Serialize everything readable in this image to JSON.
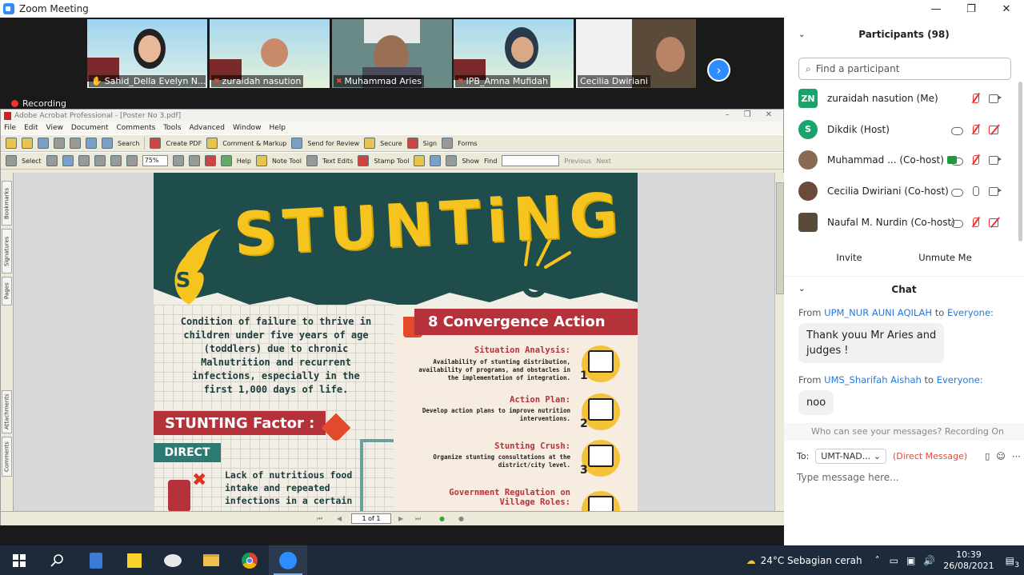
{
  "zoom": {
    "title": "Zoom Meeting",
    "recording": "Recording",
    "win_min": "—",
    "win_max": "❐",
    "win_close": "✕"
  },
  "videos": [
    {
      "name": "Sahid_Della Evelyn N..."
    },
    {
      "name": "zuraidah nasution"
    },
    {
      "name": "Muhammad Aries"
    },
    {
      "name": "IPB_Amna Mufidah"
    },
    {
      "name": "Cecilia Dwiriani"
    }
  ],
  "acrobat": {
    "title": "Adobe Acrobat Professional - [Poster No 3.pdf]",
    "menu": [
      "File",
      "Edit",
      "View",
      "Document",
      "Comments",
      "Tools",
      "Advanced",
      "Window",
      "Help"
    ],
    "toolbar1": {
      "search": "Search",
      "create_pdf": "Create PDF",
      "comment": "Comment & Markup",
      "send_review": "Send for Review",
      "secure": "Secure",
      "sign": "Sign",
      "forms": "Forms"
    },
    "toolbar2": {
      "select": "Select",
      "zoom": "75%",
      "help": "Help",
      "note_tool": "Note Tool",
      "text_edits": "Text Edits",
      "stamp_tool": "Stamp Tool",
      "show": "Show",
      "find": "Find",
      "previous": "Previous",
      "next": "Next"
    },
    "side_tabs": [
      "Bookmarks",
      "Signatures",
      "Pages",
      "Attachments",
      "Comments"
    ],
    "page": "1 of 1"
  },
  "poster": {
    "title": "STUNTiNG",
    "is": "IS",
    "definition": "Condition of failure to thrive in children under five years of age (toddlers) due to chronic Malnutrition and recurrent infections, especially in the first 1,000 days of life.",
    "factor_heading": "STUNTING Factor :",
    "direct": "DIRECT",
    "lack": "Lack of nutritious food intake and repeated infections in a certain",
    "convergence_heading": "8 Convergence Action",
    "actions": [
      {
        "title": "Situation Analysis:",
        "desc": "Availability of stunting distribution, availability of programs, and obstacles in the implementation of integration.",
        "num": "1"
      },
      {
        "title": "Action Plan:",
        "desc": "Develop action plans to improve nutrition interventions.",
        "num": "2"
      },
      {
        "title": "Stunting Crush:",
        "desc": "Organize stunting consultations at the district/city level.",
        "num": "3"
      },
      {
        "title": "Government Regulation on Village Roles:",
        "desc": "",
        "num": ""
      }
    ]
  },
  "participants": {
    "header": "Participants (98)",
    "search_placeholder": "Find a participant",
    "list": [
      {
        "initials": "ZN",
        "name": "zuraidah nasution (Me)",
        "color": "#1aa36b"
      },
      {
        "initials": "S",
        "name": "Dikdik (Host)",
        "color": "#1aa36b"
      },
      {
        "initials": "",
        "name": "Muhammad ... (Co-host)",
        "color": "#8a6a55"
      },
      {
        "initials": "",
        "name": "Cecilia Dwiriani (Co-host)",
        "color": "#6b4a3a"
      },
      {
        "initials": "",
        "name": "Naufal M. Nurdin (Co-host)",
        "color": "#5a4a3a"
      }
    ],
    "invite": "Invite",
    "unmute": "Unmute Me"
  },
  "chat": {
    "header": "Chat",
    "messages": [
      {
        "from_prefix": "From",
        "from": "UPM_NUR AUNI AQILAH",
        "to_word": "to",
        "to": "Everyone:",
        "text_line1": "Thank youu Mr Aries and",
        "text_line2": "judges !"
      },
      {
        "from_prefix": "From",
        "from": "UMS_Sharifah Aishah",
        "to_word": "to",
        "to": "Everyone:",
        "text_line1": "noo",
        "text_line2": ""
      }
    ],
    "who_can_see": "Who can see your messages? Recording On",
    "to_label": "To:",
    "to_select": "UMT-NAD...",
    "direct_message": "(Direct Message)",
    "placeholder": "Type message here..."
  },
  "taskbar": {
    "weather": "24°C  Sebagian cerah",
    "time": "10:39",
    "date": "26/08/2021",
    "notif": "3"
  }
}
